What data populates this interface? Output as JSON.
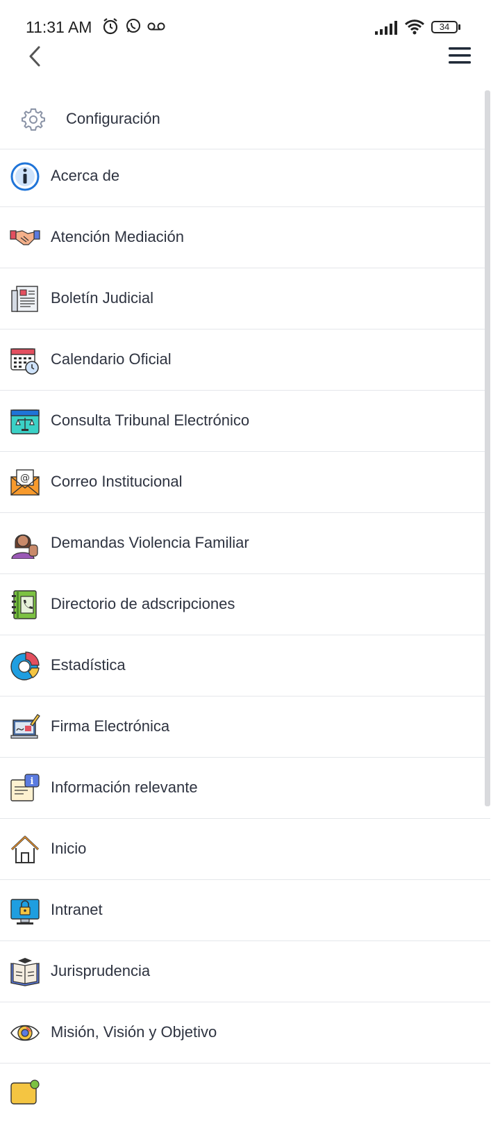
{
  "status_bar": {
    "time": "11:31 AM",
    "battery": "34"
  },
  "header": {
    "back_icon": "chevron-left-icon",
    "menu_icon": "hamburger-menu-icon"
  },
  "menu": {
    "settings_label": "Configuración",
    "items": [
      {
        "label": "Acerca de",
        "icon": "info-icon"
      },
      {
        "label": "Atención Mediación",
        "icon": "handshake-icon"
      },
      {
        "label": "Boletín Judicial",
        "icon": "newspaper-icon"
      },
      {
        "label": "Calendario Oficial",
        "icon": "calendar-clock-icon"
      },
      {
        "label": "Consulta Tribunal Electrónico",
        "icon": "scales-calendar-icon"
      },
      {
        "label": "Correo Institucional",
        "icon": "mail-icon"
      },
      {
        "label": "Demandas Violencia Familiar",
        "icon": "woman-stop-icon"
      },
      {
        "label": "Directorio de adscripciones",
        "icon": "phonebook-icon"
      },
      {
        "label": "Estadística",
        "icon": "pie-chart-icon"
      },
      {
        "label": "Firma Electrónica",
        "icon": "laptop-signature-icon"
      },
      {
        "label": "Información relevante",
        "icon": "info-document-icon"
      },
      {
        "label": "Inicio",
        "icon": "home-icon"
      },
      {
        "label": "Intranet",
        "icon": "monitor-lock-icon"
      },
      {
        "label": "Jurisprudencia",
        "icon": "law-book-icon"
      },
      {
        "label": "Misión, Visión y Objetivo",
        "icon": "eye-icon"
      },
      {
        "label": "",
        "icon": "next-item-icon"
      }
    ]
  }
}
